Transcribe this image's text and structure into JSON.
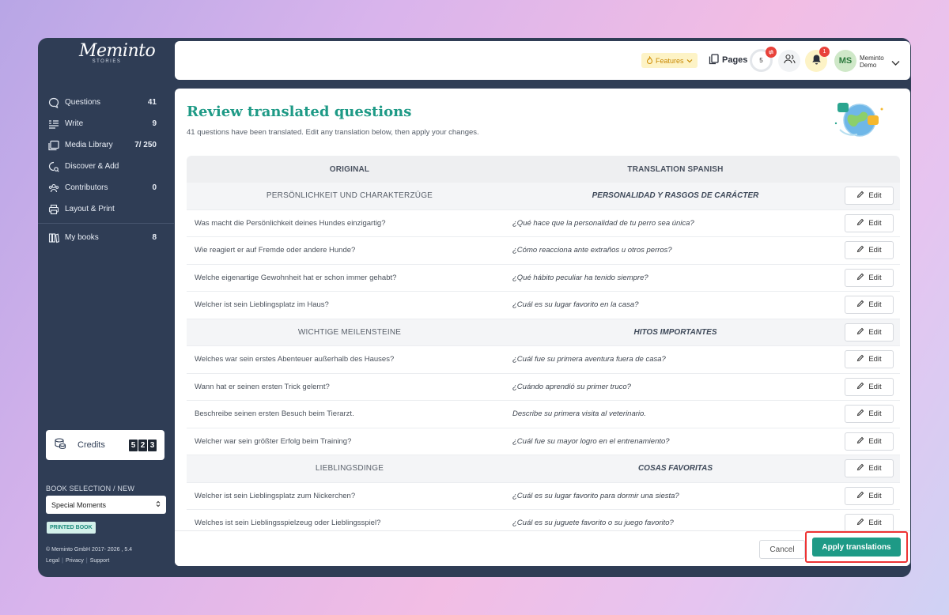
{
  "brand": {
    "logo": "Meminto",
    "logo_sub": "STORIES"
  },
  "sidebar": {
    "items": [
      {
        "label": "Questions",
        "count": "41",
        "icon": "chat-bubble-icon"
      },
      {
        "label": "Write",
        "count": "9",
        "icon": "write-icon"
      },
      {
        "label": "Media Library",
        "count": "7/ 250",
        "icon": "media-icon"
      },
      {
        "label": "Discover & Add",
        "count": "",
        "icon": "discover-icon"
      },
      {
        "label": "Contributors",
        "count": "0",
        "icon": "contributors-icon"
      },
      {
        "label": "Layout & Print",
        "count": "",
        "icon": "printer-icon"
      }
    ],
    "books": {
      "label": "My books",
      "count": "8"
    },
    "credits": {
      "label": "Credits",
      "digits": [
        "5",
        "2",
        "3"
      ]
    },
    "book_selection_label": "BOOK SELECTION / NEW",
    "book_select_value": "Special Moments",
    "printed_badge": "PRINTED BOOK",
    "copyright": "© Meminto GmbH 2017- 2026 , 5.4",
    "links": [
      "Legal",
      "Privacy",
      "Support"
    ]
  },
  "topbar": {
    "features": "Features",
    "pages": "Pages",
    "pages_count": "5",
    "notifications": "1",
    "avatar": "MS",
    "user_line1": "Meminto",
    "user_line2": "Demo"
  },
  "main": {
    "title": "Review translated questions",
    "subtitle": "41 questions have been translated. Edit any translation below, then apply your changes.",
    "col_original": "ORIGINAL",
    "col_translation": "TRANSLATION SPANISH",
    "edit_label": "Edit",
    "rows": [
      {
        "section": true,
        "original": "PERSÖNLICHKEIT UND CHARAKTERZÜGE",
        "translation": "PERSONALIDAD Y RASGOS DE CARÁCTER"
      },
      {
        "section": false,
        "original": "Was macht die Persönlichkeit deines Hundes einzigartig?",
        "translation": "¿Qué hace que la personalidad de tu perro sea única?"
      },
      {
        "section": false,
        "original": "Wie reagiert er auf Fremde oder andere Hunde?",
        "translation": "¿Cómo reacciona ante extraños u otros perros?"
      },
      {
        "section": false,
        "original": "Welche eigenartige Gewohnheit hat er schon immer gehabt?",
        "translation": "¿Qué hábito peculiar ha tenido siempre?"
      },
      {
        "section": false,
        "original": "Welcher ist sein Lieblingsplatz im Haus?",
        "translation": "¿Cuál es su lugar favorito en la casa?"
      },
      {
        "section": true,
        "original": "WICHTIGE MEILENSTEINE",
        "translation": "HITOS IMPORTANTES"
      },
      {
        "section": false,
        "original": "Welches war sein erstes Abenteuer außerhalb des Hauses?",
        "translation": "¿Cuál fue su primera aventura fuera de casa?"
      },
      {
        "section": false,
        "original": "Wann hat er seinen ersten Trick gelernt?",
        "translation": "¿Cuándo aprendió su primer truco?"
      },
      {
        "section": false,
        "original": "Beschreibe seinen ersten Besuch beim Tierarzt.",
        "translation": "Describe su primera visita al veterinario."
      },
      {
        "section": false,
        "original": "Welcher war sein größter Erfolg beim Training?",
        "translation": "¿Cuál fue su mayor logro en el entrenamiento?"
      },
      {
        "section": true,
        "original": "LIEBLINGSDINGE",
        "translation": "COSAS FAVORITAS"
      },
      {
        "section": false,
        "original": "Welcher ist sein Lieblingsplatz zum Nickerchen?",
        "translation": "¿Cuál es su lugar favorito para dormir una siesta?"
      },
      {
        "section": false,
        "original": "Welches ist sein Lieblingsspielzeug oder Lieblingsspiel?",
        "translation": "¿Cuál es su juguete favorito o su juego favorito?"
      }
    ],
    "cancel": "Cancel",
    "apply": "Apply translations"
  },
  "colors": {
    "accent": "#1e9a86",
    "sidebar": "#2f3d55",
    "alert": "#e8423a"
  }
}
